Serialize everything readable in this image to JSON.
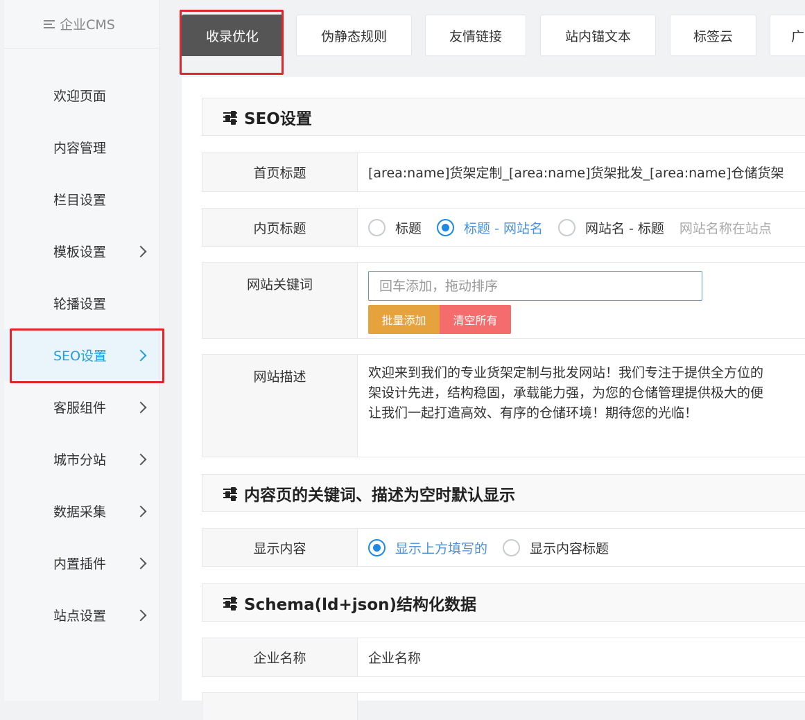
{
  "app": {
    "logo_text": "企业CMS"
  },
  "sidebar": {
    "items": [
      {
        "label": "欢迎页面",
        "chevron": false
      },
      {
        "label": "内容管理",
        "chevron": false
      },
      {
        "label": "栏目设置",
        "chevron": false
      },
      {
        "label": "模板设置",
        "chevron": true
      },
      {
        "label": "轮播设置",
        "chevron": false
      },
      {
        "label": "SEO设置",
        "chevron": true,
        "active": true
      },
      {
        "label": "客服组件",
        "chevron": true
      },
      {
        "label": "城市分站",
        "chevron": true
      },
      {
        "label": "数据采集",
        "chevron": true
      },
      {
        "label": "内置插件",
        "chevron": true
      },
      {
        "label": "站点设置",
        "chevron": true
      }
    ]
  },
  "tabs": [
    {
      "label": "收录优化",
      "active": true
    },
    {
      "label": "伪静态规则"
    },
    {
      "label": "友情链接"
    },
    {
      "label": "站内锚文本"
    },
    {
      "label": "标签云"
    },
    {
      "label": "广"
    }
  ],
  "seo": {
    "section_title": "SEO设置",
    "home_title": {
      "label": "首页标题",
      "value": "[area:name]货架定制_[area:name]货架批发_[area:name]仓储货架"
    },
    "inner_title": {
      "label": "内页标题",
      "options": [
        "标题",
        "标题 - 网站名",
        "网站名 - 标题"
      ],
      "selected": "标题 - 网站名",
      "hint": "网站名称在站点"
    },
    "keywords": {
      "label": "网站关键词",
      "placeholder": "回车添加，拖动排序",
      "batch_add": "批量添加",
      "clear_all": "清空所有"
    },
    "description": {
      "label": "网站描述",
      "lines": [
        "欢迎来到我们的专业货架定制与批发网站！我们专注于提供全方位的",
        "架设计先进，结构稳固，承载能力强，为您的仓储管理提供极大的便",
        "让我们一起打造高效、有序的仓储环境！期待您的光临！"
      ]
    }
  },
  "content_default": {
    "section_title": "内容页的关键词、描述为空时默认显示",
    "display": {
      "label": "显示内容",
      "options": [
        "显示上方填写的",
        "显示内容标题"
      ],
      "selected": "显示上方填写的"
    }
  },
  "schema": {
    "section_title": "Schema(ld+json)结构化数据",
    "company": {
      "label": "企业名称",
      "value": "企业名称"
    }
  },
  "colors": {
    "accent": "#1e9fd8",
    "radio_selected": "#1e88e5",
    "highlight_border": "#e0262a",
    "batch_button": "#e6a23c",
    "clear_button": "#f56c6c",
    "active_tab": "#555555"
  },
  "icons": {
    "logo": "menu-icon",
    "section": "sliders-icon",
    "nav_expand": "chevron-right-icon"
  }
}
